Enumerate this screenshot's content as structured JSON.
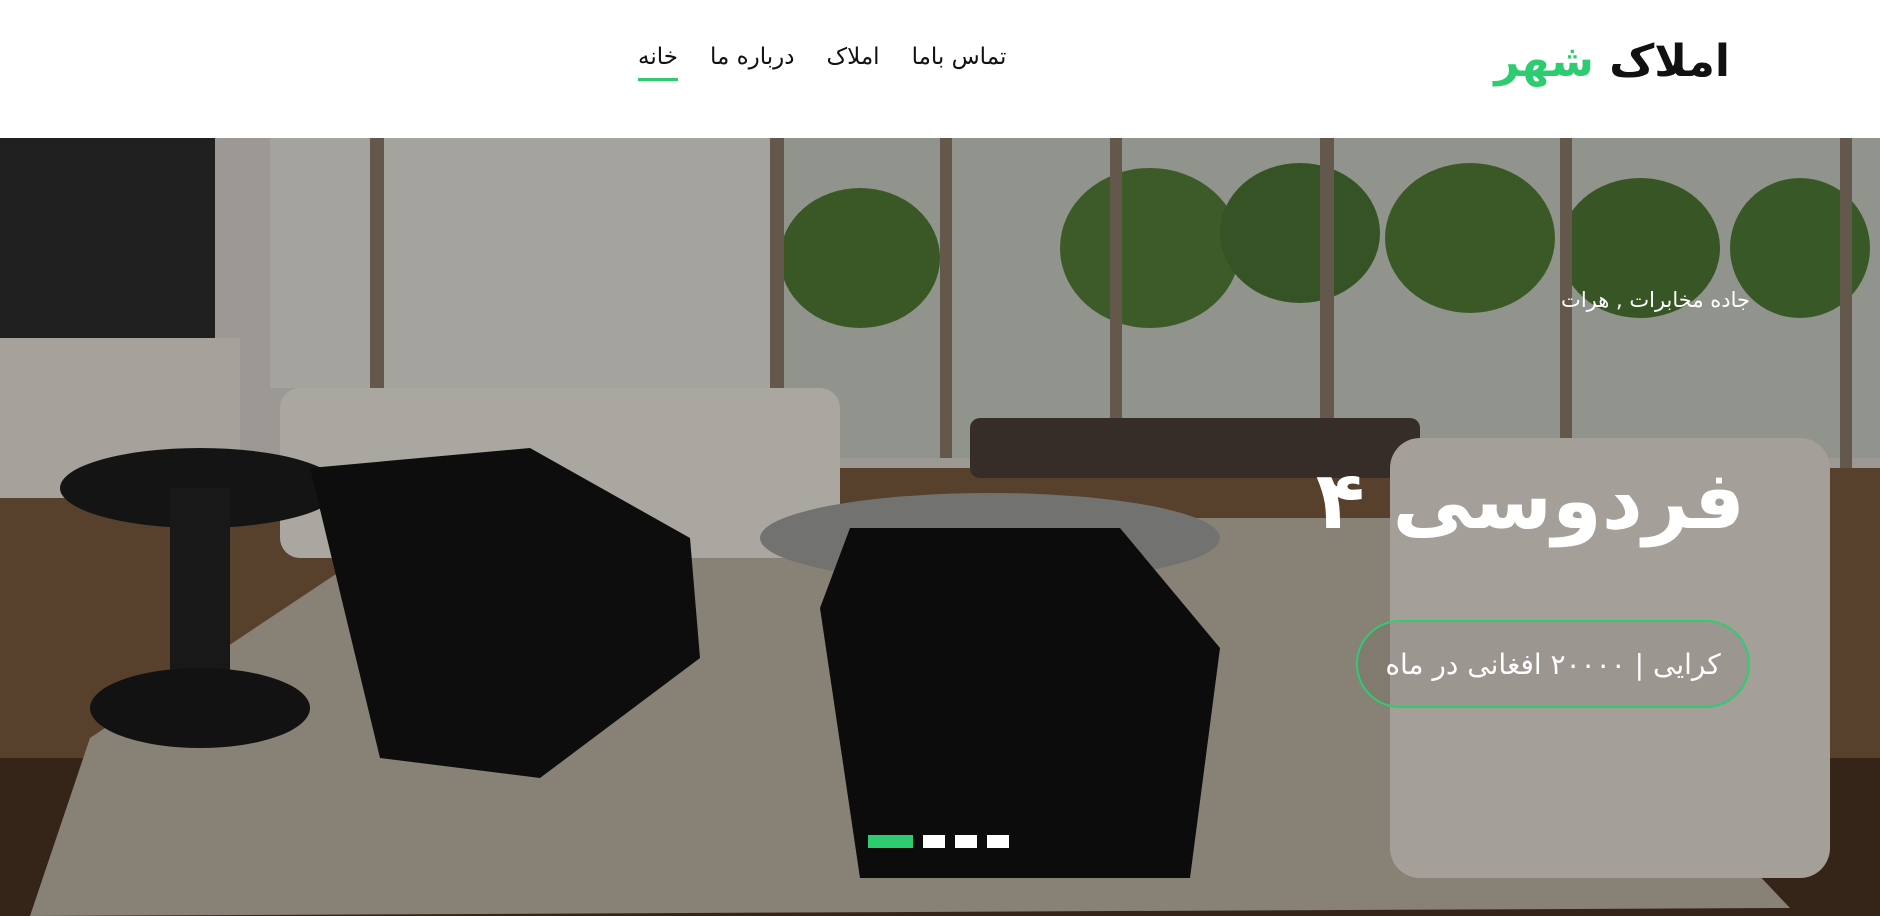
{
  "brand": {
    "name": "املاک",
    "accent": "شهر",
    "accent_color": "#2ecc71"
  },
  "nav": {
    "items": [
      {
        "label": "خانه",
        "active": true
      },
      {
        "label": "درباره ما",
        "active": false
      },
      {
        "label": "املاک",
        "active": false
      },
      {
        "label": "تماس باما",
        "active": false
      }
    ]
  },
  "hero": {
    "location": "جاده مخابرات , هرات",
    "title": "فردوسی ۴",
    "price": "کرایی | ۲۰۰۰۰ افغانی در ماه",
    "slides": {
      "count": 4,
      "active_index": 0
    }
  }
}
